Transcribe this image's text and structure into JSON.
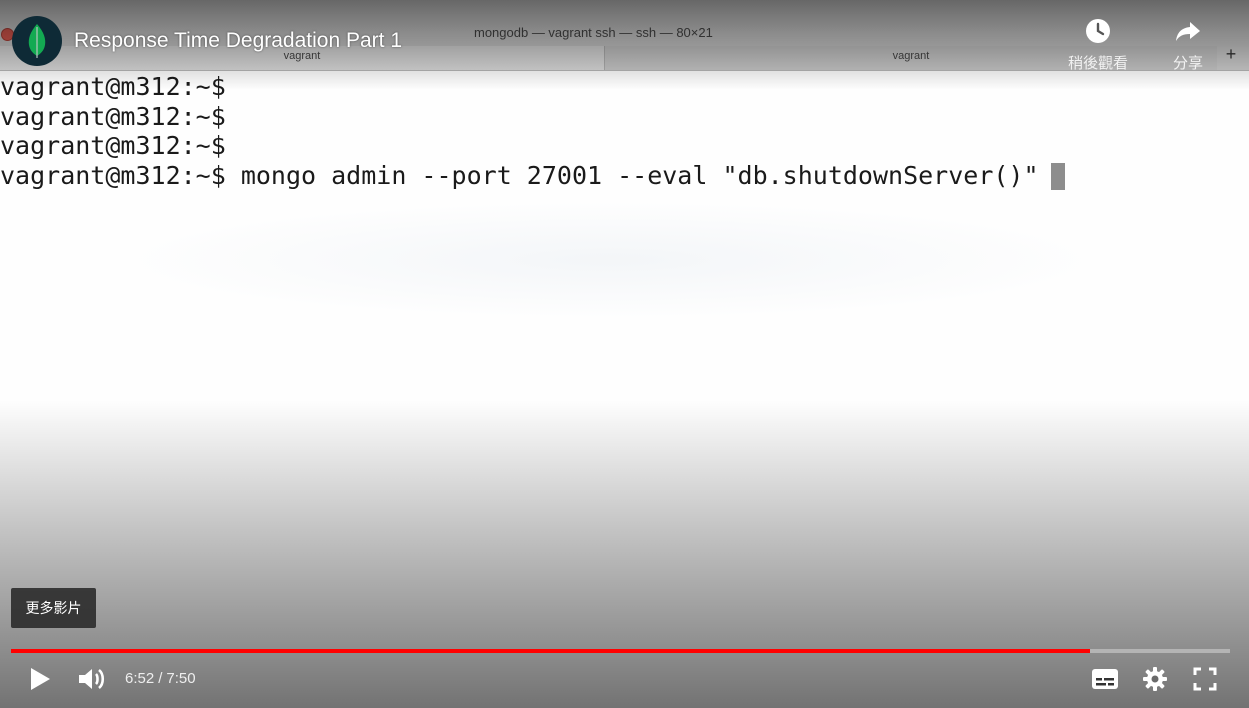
{
  "terminal": {
    "window_title": "mongodb — vagrant ssh — ssh — 80×21",
    "tabs": [
      "vagrant",
      "vagrant"
    ],
    "tab_add_label": "+",
    "lines": [
      "vagrant@m312:~$",
      "vagrant@m312:~$",
      "vagrant@m312:~$",
      "vagrant@m312:~$ mongo admin --port 27001 --eval \"db.shutdownServer()\""
    ]
  },
  "player": {
    "title": "Response Time Degradation Part 1",
    "channel_icon": "mongodb-leaf-icon",
    "actions": {
      "watch_later": "稍後觀看",
      "share": "分享"
    },
    "more_videos": "更多影片",
    "progress_fraction": 0.8851,
    "current_time": "6:52",
    "duration": "7:50",
    "time_separator": "/",
    "colors": {
      "progress": "#ff0000",
      "leaf": "#13aa52"
    }
  }
}
